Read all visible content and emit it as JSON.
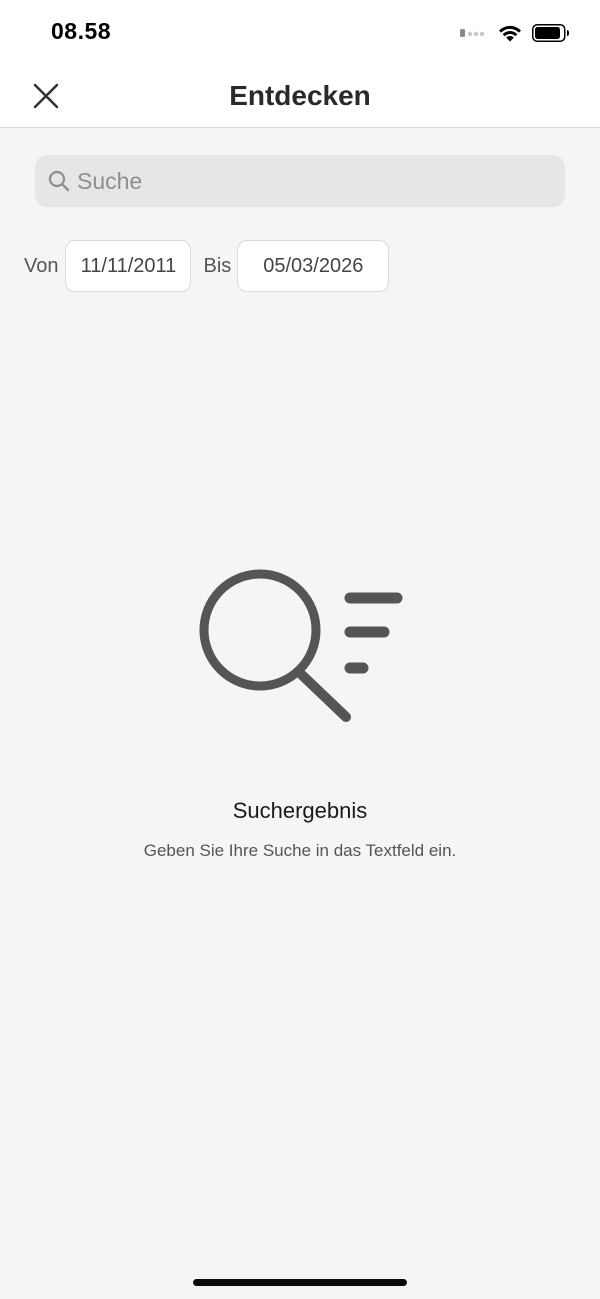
{
  "status_bar": {
    "time": "08.58"
  },
  "header": {
    "title": "Entdecken",
    "close_icon": "close-icon"
  },
  "search": {
    "placeholder": "Suche",
    "value": "",
    "icon": "search-icon"
  },
  "date_range": {
    "from_label": "Von",
    "from_value": "11/11/2011",
    "to_label": "Bis",
    "to_value": "05/03/2026"
  },
  "empty_state": {
    "icon": "search-results-icon",
    "title": "Suchergebnis",
    "message": "Geben Sie Ihre Suche in das Textfeld ein."
  },
  "colors": {
    "background": "#f5f5f5",
    "header_background": "#ffffff",
    "search_background": "#e6e6e6",
    "illustration": "#555555"
  }
}
